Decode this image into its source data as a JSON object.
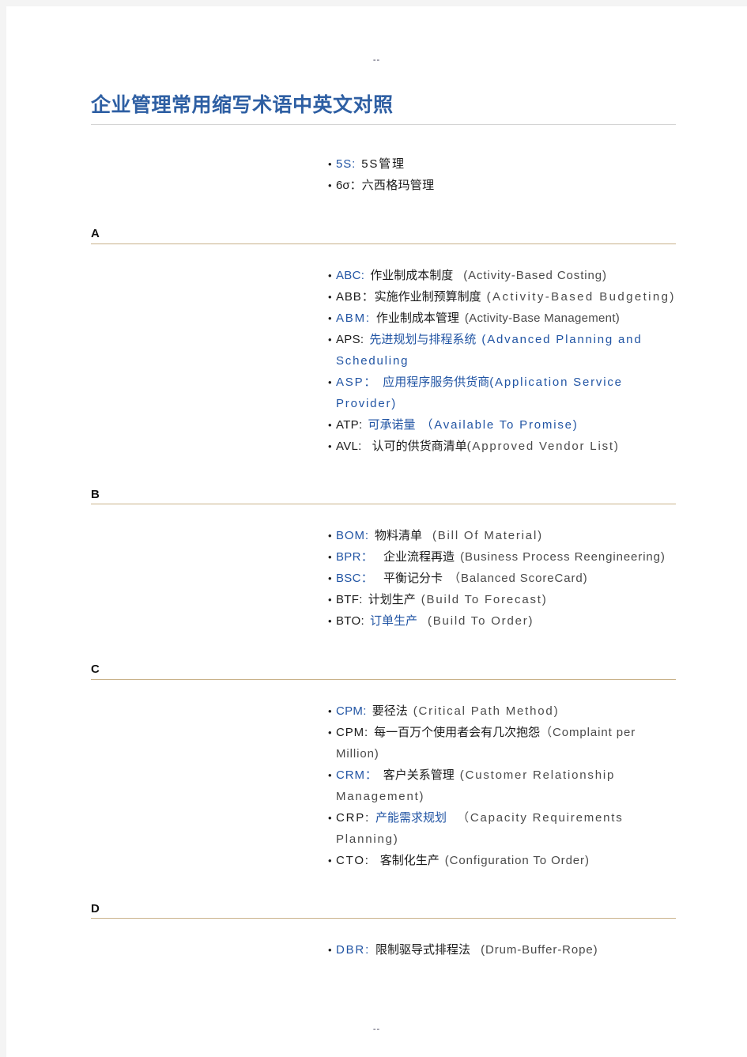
{
  "page": {
    "header_mark": "--",
    "footer_mark": "--",
    "title": "企业管理常用缩写术语中英文对照"
  },
  "intro_items": [
    {
      "abbr": "5S:",
      "cn": "5S管理"
    },
    {
      "abbr": "6σ：",
      "cn": "六西格玛管理"
    }
  ],
  "sections": [
    {
      "letter": "A",
      "items": [
        {
          "abbr": "ABC:",
          "cn": "作业制成本制度",
          "en": "(Activity-Based Costing)"
        },
        {
          "abbr": "ABB：",
          "cn": "实施作业制预算制度",
          "en": "(Activity-Based Budgeting)"
        },
        {
          "abbr": "ABM:",
          "cn": "作业制成本管理",
          "en": "(Activity-Base Management)"
        },
        {
          "abbr": "APS:",
          "cn": "先进规划与排程系统",
          "en": "(Advanced Planning and Scheduling"
        },
        {
          "abbr": "ASP：",
          "cn": "应用程序服务供货商",
          "en": "(Application Service Provider)"
        },
        {
          "abbr": "ATP:",
          "cn": "可承诺量",
          "en": "（Available To Promise)"
        },
        {
          "abbr": "AVL:",
          "cn": "认可的供货商清单",
          "en": "(Approved Vendor List)"
        }
      ]
    },
    {
      "letter": "B",
      "items": [
        {
          "abbr": "BOM:",
          "cn": "物料清单",
          "en": "(Bill Of Material)"
        },
        {
          "abbr": "BPR：",
          "cn": "企业流程再造",
          "en": "(Business Process Reengineering)"
        },
        {
          "abbr": "BSC：",
          "cn": "平衡记分卡",
          "en": "（Balanced ScoreCard)"
        },
        {
          "abbr": "BTF:",
          "cn": "计划生产",
          "en": "(Build To Forecast)"
        },
        {
          "abbr": "BTO:",
          "cn": "订单生产",
          "en": "(Build To Order)"
        }
      ]
    },
    {
      "letter": "C",
      "items": [
        {
          "abbr": "CPM:",
          "cn": "要径法",
          "en": "(Critical Path Method)"
        },
        {
          "abbr": "CPM:",
          "cn": "每一百万个使用者会有几次抱怨",
          "en": "（Complaint per Million)"
        },
        {
          "abbr": "CRM：",
          "cn": "客户关系管理",
          "en": "(Customer Relationship Management)"
        },
        {
          "abbr": "CRP:",
          "cn": "产能需求规划",
          "en": "（Capacity Requirements Planning)"
        },
        {
          "abbr": "CTO:",
          "cn": "客制化生产",
          "en": "(Configuration To Order)"
        }
      ]
    },
    {
      "letter": "D",
      "items": [
        {
          "abbr": "DBR:",
          "cn": "限制驱导式排程法",
          "en": "(Drum-Buffer-Rope)"
        }
      ]
    }
  ],
  "colors": {
    "title": "#2e5fa3",
    "accent_blue": "#2255a4",
    "section_rule": "#c9b28a",
    "title_rule": "#d4d4d4",
    "page_bg": "#ffffff",
    "canvas_bg": "#f4f4f4"
  }
}
